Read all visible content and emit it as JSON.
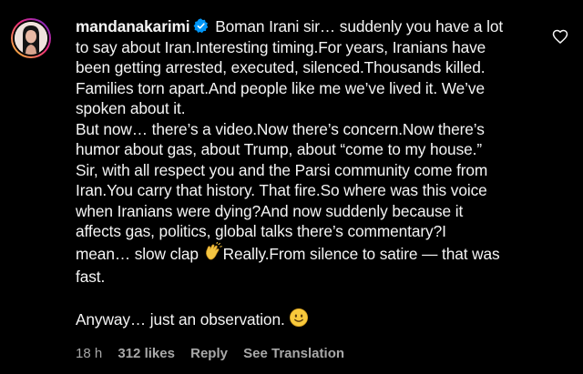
{
  "comment": {
    "username": "mandanakarimi",
    "verified": true,
    "body_lines": [
      "Boman Irani sir… suddenly you have a lot",
      "to say about Iran.Interesting timing.For years, Iranians have",
      "been getting arrested, executed, silenced.Thousands killed.",
      "Families torn apart.And people like me we’ve lived it. We’ve",
      "spoken about it.",
      "But now… there’s a video.Now there’s concern.Now there’s",
      "humor about gas, about Trump, about “come to my house.”",
      "Sir, with all respect you and the Parsi community come from",
      "Iran.You carry that history. That fire.So where was this voice",
      "when Iranians were dying?And now suddenly because it",
      "affects gas, politics, global talks there’s commentary?I",
      "mean… slow clap",
      "Really.From silence to satire — that was",
      "fast.",
      "",
      "Anyway… just an observation."
    ],
    "clap_emoji": "👏",
    "smile_emoji": "🙂"
  },
  "meta": {
    "time": "18 h",
    "likes": "312 likes",
    "reply": "Reply",
    "translation": "See Translation"
  },
  "icons": {
    "like": "heart-outline-icon",
    "verified": "verified-badge-icon"
  },
  "colors": {
    "background": "#000000",
    "text": "#f5f5f5",
    "meta": "#a8a8a8",
    "verified": "#0095f6"
  }
}
